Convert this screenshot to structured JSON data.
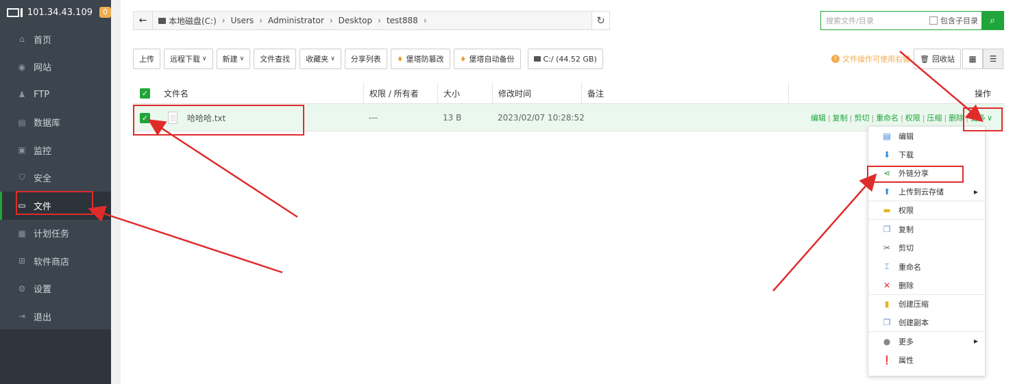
{
  "server": {
    "ip": "101.34.43.109",
    "badge": "0"
  },
  "sidebar": {
    "items": [
      {
        "label": "首页",
        "icon": "home-icon"
      },
      {
        "label": "网站",
        "icon": "globe-icon"
      },
      {
        "label": "FTP",
        "icon": "user-icon"
      },
      {
        "label": "数据库",
        "icon": "database-icon"
      },
      {
        "label": "监控",
        "icon": "monitor-icon"
      },
      {
        "label": "安全",
        "icon": "shield-icon"
      },
      {
        "label": "文件",
        "icon": "folder-icon"
      },
      {
        "label": "计划任务",
        "icon": "calendar-icon"
      },
      {
        "label": "软件商店",
        "icon": "grid-icon"
      },
      {
        "label": "设置",
        "icon": "gear-icon"
      },
      {
        "label": "退出",
        "icon": "logout-icon"
      }
    ],
    "active": "文件"
  },
  "path": {
    "crumbs": [
      "本地磁盘(C:)",
      "Users",
      "Administrator",
      "Desktop",
      "test888"
    ]
  },
  "search": {
    "placeholder": "搜索文件/目录",
    "subdir_label": "包含子目录"
  },
  "toolbar": {
    "upload": "上传",
    "remote_download": "远程下载",
    "new": "新建",
    "find": "文件查找",
    "favorites": "收藏夹",
    "share_list": "分享列表",
    "tamper": "堡塔防篡改",
    "backup": "堡塔自动备份",
    "disk": "C:/ (44.52 GB)",
    "tip": "文件操作可使用右键",
    "recycle": "回收站"
  },
  "table": {
    "headers": {
      "name": "文件名",
      "perm": "权限 / 所有者",
      "size": "大小",
      "mtime": "修改时间",
      "note": "备注",
      "ops": "操作"
    },
    "rows": [
      {
        "name": "哈哈哈.txt",
        "perm": "---",
        "size": "13 B",
        "mtime": "2023/02/07 10:28:52",
        "note": ""
      }
    ],
    "row_ops": [
      "编辑",
      "复制",
      "剪切",
      "重命名",
      "权限",
      "压缩",
      "删除"
    ],
    "more": "更多"
  },
  "context_menu": {
    "items": [
      {
        "label": "编辑",
        "icon": "edit-icon"
      },
      {
        "label": "下载",
        "icon": "download-icon"
      },
      {
        "label": "外链分享",
        "icon": "share-icon"
      },
      {
        "label": "上传到云存储",
        "icon": "cloud-upload-icon"
      },
      {
        "label": "权限",
        "icon": "permission-icon"
      },
      {
        "label": "复制",
        "icon": "copy-icon"
      },
      {
        "label": "剪切",
        "icon": "scissors-icon"
      },
      {
        "label": "重命名",
        "icon": "rename-icon"
      },
      {
        "label": "删除",
        "icon": "delete-icon"
      },
      {
        "label": "创建压缩",
        "icon": "archive-icon"
      },
      {
        "label": "创建副本",
        "icon": "duplicate-icon"
      },
      {
        "label": "更多",
        "icon": "more-icon"
      },
      {
        "label": "属性",
        "icon": "info-icon"
      }
    ]
  },
  "colors": {
    "accent": "#20a53a",
    "sidebar": "#3c444d",
    "annotation": "#e02b2b",
    "tip": "#f0ad4e"
  }
}
